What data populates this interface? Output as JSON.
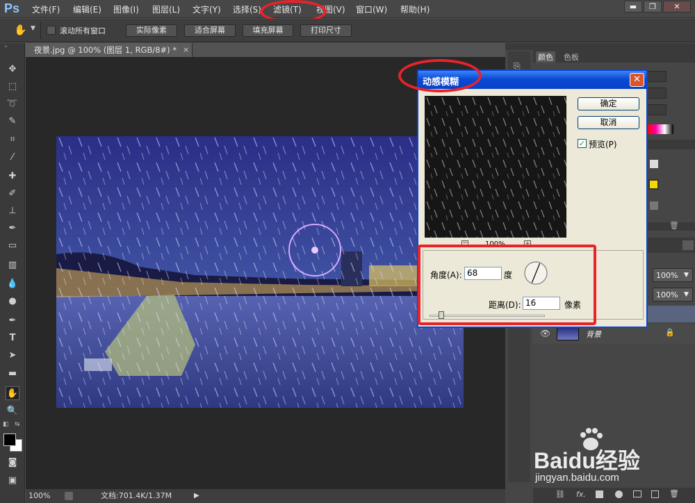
{
  "app": {
    "logo": "Ps"
  },
  "menubar": {
    "items": [
      "文件(F)",
      "编辑(E)",
      "图像(I)",
      "图层(L)",
      "文字(Y)",
      "选择(S)",
      "滤镜(T)",
      "视图(V)",
      "窗口(W)",
      "帮助(H)"
    ],
    "window_buttons": [
      "▬",
      "❐",
      "✕"
    ]
  },
  "options": {
    "scroll_all_label": "滚动所有窗口",
    "scroll_all_checked": false,
    "buttons": [
      "实际像素",
      "适合屏幕",
      "填充屏幕",
      "打印尺寸"
    ]
  },
  "document": {
    "tab_title": "夜景.jpg @ 100% (图层 1, RGB/8#) *",
    "zoom": "100%",
    "doc_info": "文档:701.4K/1.37M"
  },
  "panels": {
    "color_tab": "颜色",
    "swatches_tab": "色板",
    "layer_opacity": "100%",
    "layer_fill": "100%",
    "background_layer_name": "背景"
  },
  "dialog": {
    "title": "动感模糊",
    "ok_label": "确定",
    "cancel_label": "取消",
    "preview_label": "预览(P)",
    "preview_checked": true,
    "zoom_minus": "−",
    "zoom_plus": "+",
    "zoom_level": "100%",
    "angle_label": "角度(A):",
    "angle_value": "68",
    "angle_unit": "度",
    "distance_label": "距离(D):",
    "distance_value": "16",
    "distance_unit": "像素",
    "distance_slider_level": 0.1
  },
  "watermark": {
    "brand": "Baidu经验",
    "url": "jingyan.baidu.com"
  },
  "colors": {
    "highlight": "#e8232a",
    "dialog_titlebar": "#0a4ad4",
    "dialog_bg": "#ece9d8"
  }
}
